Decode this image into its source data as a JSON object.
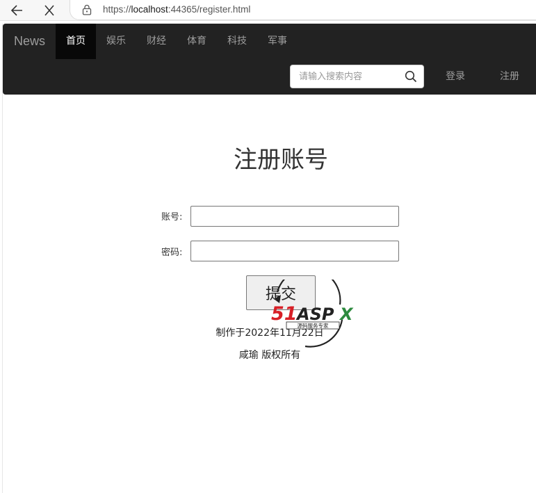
{
  "browser": {
    "url_scheme": "https://",
    "url_host": "localhost",
    "url_rest": ":44365/register.html"
  },
  "navbar": {
    "brand": "News",
    "items": [
      {
        "label": "首页",
        "active": true
      },
      {
        "label": "娱乐"
      },
      {
        "label": "财经"
      },
      {
        "label": "体育"
      },
      {
        "label": "科技"
      },
      {
        "label": "军事"
      }
    ],
    "search_placeholder": "请输入搜索内容",
    "login_label": "登录",
    "register_label": "注册"
  },
  "form": {
    "title": "注册账号",
    "account_label": "账号:",
    "account_value": "",
    "password_label": "密码:",
    "password_value": "",
    "submit_label": "提交"
  },
  "footer": {
    "made_on": "制作于2022年11月22日",
    "copyright": "咸瑜 版权所有"
  },
  "watermark": {
    "logo_text": "51ASPX",
    "tagline": "源码服务专家"
  }
}
